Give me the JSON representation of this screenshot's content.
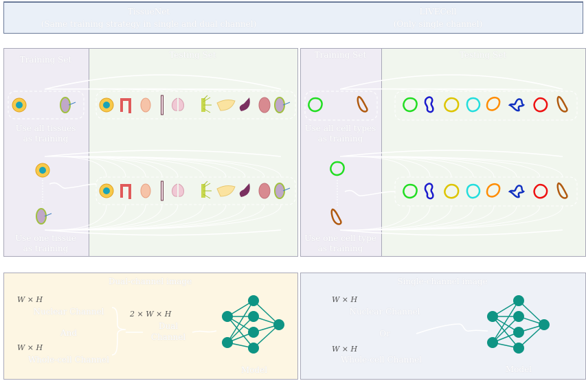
{
  "header": {
    "tissuenet": {
      "title": "TissueNet",
      "subtitle": "(Same training strategy in single and dual channel)"
    },
    "livecell": {
      "title": "LIVECell",
      "subtitle": "(Only single channel)"
    }
  },
  "tissuenet_panel": {
    "training_label": "Training Set",
    "testing_label": "Testing Set",
    "all_label": [
      "Use all tissues",
      "as training"
    ],
    "one_label": [
      "Use one tissue",
      "as training"
    ],
    "tissue_icons": [
      "cell",
      "colon",
      "breast",
      "esophagus",
      "lung",
      "lymph-vessel",
      "pancreas",
      "spleen",
      "tonsil",
      "lymph-node"
    ]
  },
  "livecell_panel": {
    "training_label": "Training Set",
    "testing_label": "Testing Set",
    "all_label": [
      "Use all cell types",
      "as training"
    ],
    "one_label": [
      "Use one cell type",
      "as training"
    ],
    "cell_colors": [
      "#22dd22",
      "#1a1acc",
      "#ddc400",
      "#22dddd",
      "#ff8c00",
      "#1030c0",
      "#ee1111",
      "#b05a10"
    ]
  },
  "dual": {
    "title": "Dual-channel image",
    "dim1": "W × H",
    "ch1": "Nuclear Channel",
    "conj": "And",
    "dim2": "W × H",
    "ch2": "Whole-cell Channel",
    "out_dim": "2 × W × H",
    "out_label": [
      "Dual",
      "Channel"
    ],
    "model": "Model"
  },
  "single": {
    "title": "Single-channel image",
    "dim1": "W × H",
    "ch1": "Nuclear Channel",
    "conj": "Or",
    "dim2": "W × H",
    "ch2": "Whole-cell Channel",
    "model": "Model"
  },
  "colors": {
    "model": "#0e9484",
    "header_bg": "#eaf0f8",
    "train_bg": "#efecf4",
    "test_bg": "#f1f6ee",
    "dual_bg": "#fdf6e3",
    "single_bg": "#eef1f7"
  }
}
